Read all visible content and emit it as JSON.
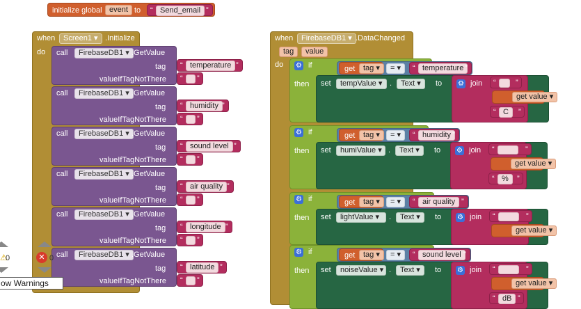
{
  "global": {
    "init": "initialize global",
    "var_name": "event",
    "to": "to",
    "value": "Send_email"
  },
  "screen_event": {
    "when": "when",
    "component": "Screen1",
    "event": ".Initialize",
    "do": "do",
    "calls": [
      {
        "call": "call",
        "component": "FirebaseDB1",
        "method": ".GetValue",
        "tag_label": "tag",
        "tag": "temperature",
        "default_label": "valueIfTagNotThere",
        "default": ""
      },
      {
        "call": "call",
        "component": "FirebaseDB1",
        "method": ".GetValue",
        "tag_label": "tag",
        "tag": "humidity",
        "default_label": "valueIfTagNotThere",
        "default": ""
      },
      {
        "call": "call",
        "component": "FirebaseDB1",
        "method": ".GetValue",
        "tag_label": "tag",
        "tag": "sound level",
        "default_label": "valueIfTagNotThere",
        "default": ""
      },
      {
        "call": "call",
        "component": "FirebaseDB1",
        "method": ".GetValue",
        "tag_label": "tag",
        "tag": "air quality",
        "default_label": "valueIfTagNotThere",
        "default": ""
      },
      {
        "call": "call",
        "component": "FirebaseDB1",
        "method": ".GetValue",
        "tag_label": "tag",
        "tag": "longitude",
        "default_label": "valueIfTagNotThere",
        "default": ""
      },
      {
        "call": "call",
        "component": "FirebaseDB1",
        "method": ".GetValue",
        "tag_label": "tag",
        "tag": "latitude",
        "default_label": "valueIfTagNotThere",
        "default": ""
      }
    ]
  },
  "firebase_event": {
    "when": "when",
    "component": "FirebaseDB1",
    "event": ".DataChanged",
    "params": [
      "tag",
      "value"
    ],
    "do": "do",
    "ifs": [
      {
        "if": "if",
        "then": "then",
        "get": "get",
        "var": "tag",
        "op": "=",
        "compare": "temperature",
        "set": "set",
        "target": "tempValue",
        "prop": "Text",
        "to": "to",
        "join": "join",
        "parts": [
          "",
          "get value",
          "C"
        ]
      },
      {
        "if": "if",
        "then": "then",
        "get": "get",
        "var": "tag",
        "op": "=",
        "compare": "humidity",
        "set": "set",
        "target": "humiValue",
        "prop": "Text",
        "to": "to",
        "join": "join",
        "parts": [
          "",
          "get value",
          "%"
        ]
      },
      {
        "if": "if",
        "then": "then",
        "get": "get",
        "var": "tag",
        "op": "=",
        "compare": "air quality",
        "set": "set",
        "target": "lightValue",
        "prop": "Text",
        "to": "to",
        "join": "join",
        "parts": [
          "",
          "get value"
        ]
      },
      {
        "if": "if",
        "then": "then",
        "get": "get",
        "var": "tag",
        "op": "=",
        "compare": "sound level",
        "set": "set",
        "target": "noiseValue",
        "prop": "Text",
        "to": "to",
        "join": "join",
        "parts": [
          "",
          "get value",
          "dB"
        ]
      }
    ]
  },
  "warnings": {
    "warning_count": "0",
    "error_count": "0",
    "toggle_label": "ow Warnings"
  },
  "colors": {
    "event": "#b18e35",
    "global": "#d05f2d",
    "component": "#7a5690",
    "control": "#8bb23a",
    "setter": "#266643",
    "text": "#b32d5e",
    "compare": "#5b80a5"
  }
}
